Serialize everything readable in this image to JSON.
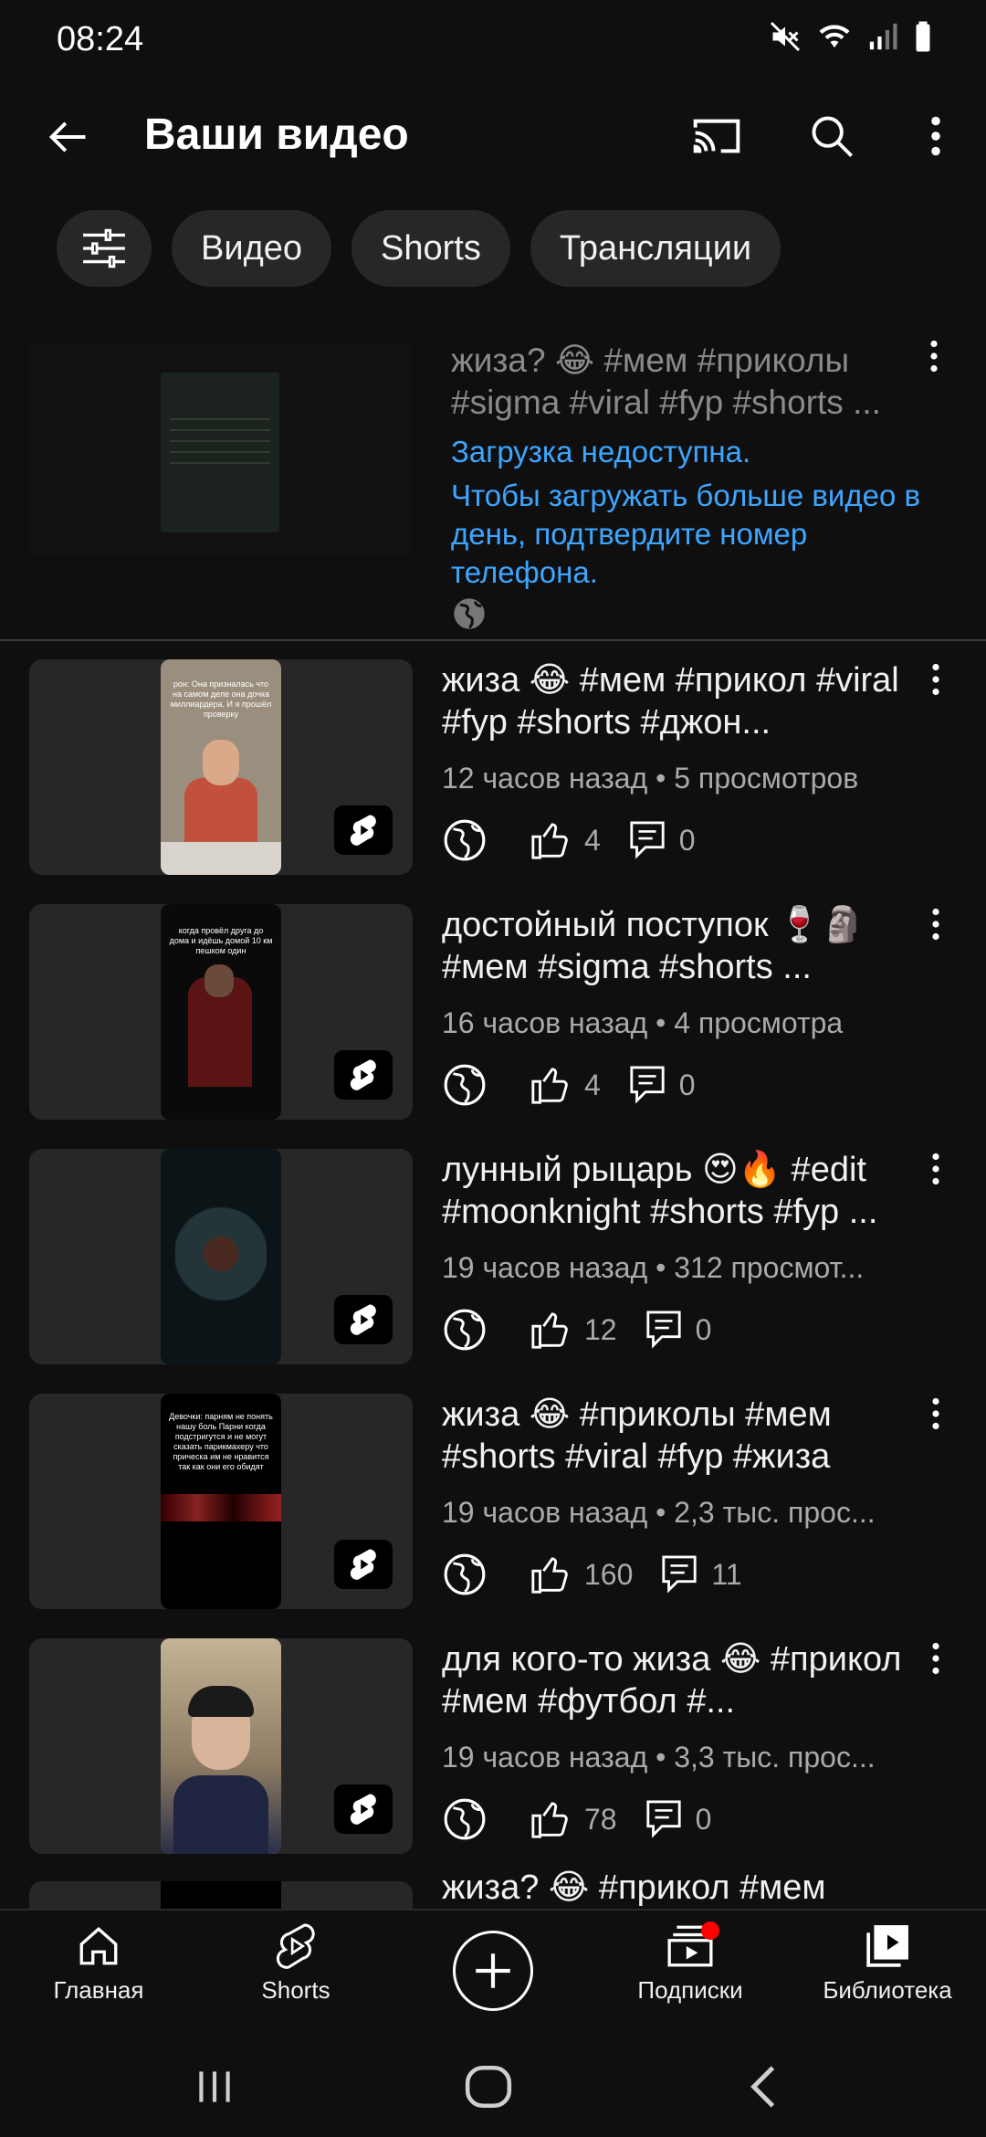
{
  "status": {
    "time": "08:24"
  },
  "appbar": {
    "title": "Ваши видео"
  },
  "chips": [
    "Видео",
    "Shorts",
    "Трансляции"
  ],
  "upload_item": {
    "title": "жиза? 😂 #мем #приколы #sigma #viral #fyp #shorts ...",
    "error_line1": "Загрузка недоступна.",
    "error_line2": "Чтобы загружать больше видео в день, подтвердите номер телефона.",
    "visibility_icon": "globe-icon"
  },
  "videos": [
    {
      "title": "жиза 😂 #мем #прикол #viral #fyp #shorts #джон...",
      "meta": "12 часов назад • 5 просмотров",
      "likes": "4",
      "comments": "0"
    },
    {
      "title": "достойный поступок 🍷🗿 #мем #sigma #shorts ...",
      "meta": "16 часов назад • 4 просмотра",
      "likes": "4",
      "comments": "0"
    },
    {
      "title": "лунный рыцарь 😍🔥 #edit #moonknight #shorts #fyp ...",
      "meta": "19 часов назад • 312 просмот...",
      "likes": "12",
      "comments": "0"
    },
    {
      "title": "жиза 😂 #приколы #мем #shorts #viral #fyp #жиза",
      "meta": "19 часов назад • 2,3 тыс. прос...",
      "likes": "160",
      "comments": "11"
    },
    {
      "title": "для кого-то жиза 😂 #прикол #мем #футбол #...",
      "meta": "19 часов назад • 3,3 тыс. прос...",
      "likes": "78",
      "comments": "0"
    }
  ],
  "partial_video": {
    "title": "жиза? 😂 #прикол #мем"
  },
  "thumb_text": {
    "v1": "рон: Она призналась что на самом деле она дочка миллиардера. И я прошёл проверку",
    "v2": "когда провёл друга до дома и идёшь домой 10 км пешком один",
    "v4": "Девочки: парням не понять нашу боль Парни когда подстригутся и не могут сказать парикмахеру что прическа им не нравится так как они его обидят"
  },
  "bottom_nav": {
    "home": "Главная",
    "shorts": "Shorts",
    "subscriptions": "Подписки",
    "library": "Библиотека"
  },
  "colors": {
    "background": "#0f0f0f",
    "link": "#3ea6ff",
    "notification": "#ff0000",
    "chip": "#272727"
  }
}
